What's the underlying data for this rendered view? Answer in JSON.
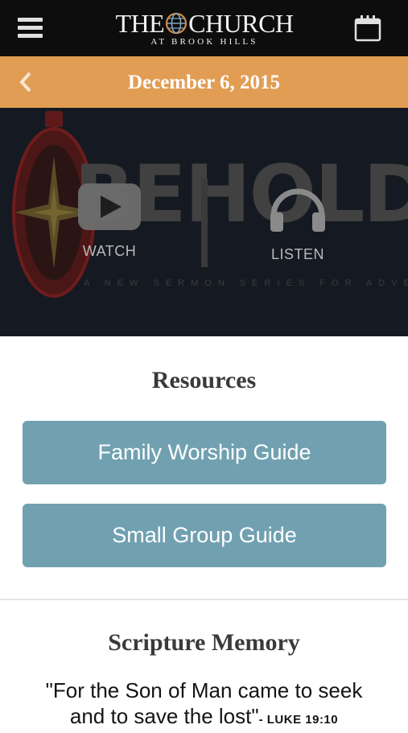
{
  "header": {
    "logo_main_left": "THE",
    "logo_main_right": "CHURCH",
    "logo_sub": "AT BROOK HILLS",
    "menu_icon": "hamburger-menu-icon",
    "calendar_icon": "calendar-icon"
  },
  "datebar": {
    "back_icon": "chevron-left-icon",
    "date": "December 6, 2015"
  },
  "hero": {
    "series_title": "BEHOLD",
    "series_subtitle": "A NEW SERMON SERIES FOR ADVENT",
    "watch_label": "WATCH",
    "listen_label": "LISTEN",
    "watch_icon": "play-icon",
    "listen_icon": "headphones-icon"
  },
  "resources": {
    "title": "Resources",
    "buttons": [
      {
        "label": "Family Worship Guide"
      },
      {
        "label": "Small Group Guide"
      }
    ]
  },
  "scripture_memory": {
    "title": "Scripture Memory",
    "verse_line1": "\"For the Son of Man came to seek",
    "verse_line2": "and to save the lost\"",
    "reference": "- LUKE 19:10"
  },
  "colors": {
    "topbar": "#0d0d0d",
    "datebar": "#e29d55",
    "hero_bg": "#151a22",
    "button": "#71a1b1"
  }
}
